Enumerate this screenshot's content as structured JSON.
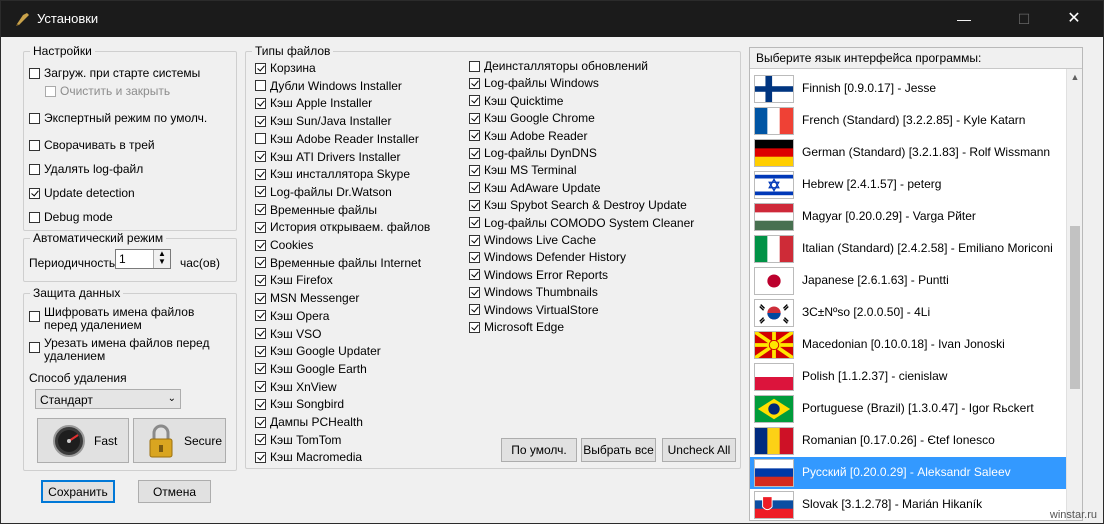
{
  "window": {
    "title": "Установки"
  },
  "settings": {
    "legend": "Настройки",
    "items": [
      {
        "label": "Загруж. при старте системы",
        "checked": false
      },
      {
        "label": "Очистить и закрыть",
        "checked": false,
        "disabled": true
      },
      {
        "label": "Экспертный режим по умолч.",
        "checked": false
      },
      {
        "label": "Сворачивать в трей",
        "checked": false
      },
      {
        "label": "Удалять log-файл",
        "checked": false
      },
      {
        "label": "Update detection",
        "checked": true
      },
      {
        "label": "Debug mode",
        "checked": false
      }
    ]
  },
  "auto": {
    "legend": "Автоматический режим",
    "period_label": "Периодичность:",
    "period_value": "1",
    "unit": "час(ов)"
  },
  "protect": {
    "legend": "Защита данных",
    "encrypt_label": "Шифровать имена файлов перед удалением",
    "trim_label": "Урезать имена файлов перед удалением",
    "method_label": "Способ удаления",
    "method_value": "Стандарт",
    "fast_label": "Fast",
    "secure_label": "Secure"
  },
  "filetypes": {
    "legend": "Типы файлов",
    "col1": [
      {
        "label": "Корзина",
        "checked": true
      },
      {
        "label": "Дубли Windows Installer",
        "checked": false
      },
      {
        "label": "Кэш Apple Installer",
        "checked": true
      },
      {
        "label": "Кэш Sun/Java Installer",
        "checked": true
      },
      {
        "label": "Кэш Adobe Reader Installer",
        "checked": false
      },
      {
        "label": "Кэш ATI Drivers Installer",
        "checked": true
      },
      {
        "label": "Кэш инсталлятора Skype",
        "checked": true
      },
      {
        "label": "Log-файлы Dr.Watson",
        "checked": true
      },
      {
        "label": "Временные файлы",
        "checked": true
      },
      {
        "label": "История открываем. файлов",
        "checked": true
      },
      {
        "label": "Cookies",
        "checked": true
      },
      {
        "label": "Временные файлы Internet",
        "checked": true
      },
      {
        "label": "Кэш Firefox",
        "checked": true
      },
      {
        "label": "MSN Messenger",
        "checked": true
      },
      {
        "label": "Кэш Opera",
        "checked": true
      },
      {
        "label": "Кэш VSO",
        "checked": true
      },
      {
        "label": "Кэш Google Updater",
        "checked": true
      },
      {
        "label": "Кэш Google Earth",
        "checked": true
      },
      {
        "label": "Кэш XnView",
        "checked": true
      },
      {
        "label": "Кэш Songbird",
        "checked": true
      },
      {
        "label": "Дампы PCHealth",
        "checked": true
      },
      {
        "label": "Кэш TomTom",
        "checked": true
      },
      {
        "label": "Кэш Macromedia",
        "checked": true
      }
    ],
    "col2": [
      {
        "label": "Деинсталляторы обновлений",
        "checked": false
      },
      {
        "label": "Log-файлы Windows",
        "checked": true
      },
      {
        "label": "Кэш Quicktime",
        "checked": true
      },
      {
        "label": "Кэш Google Chrome",
        "checked": true
      },
      {
        "label": "Кэш Adobe Reader",
        "checked": true
      },
      {
        "label": "Log-файлы DynDNS",
        "checked": true
      },
      {
        "label": "Кэш MS Terminal",
        "checked": true
      },
      {
        "label": "Кэш AdAware Update",
        "checked": true
      },
      {
        "label": "Кэш Spybot Search & Destroy Update",
        "checked": true
      },
      {
        "label": "Log-файлы COMODO System Cleaner",
        "checked": true
      },
      {
        "label": "Windows Live Cache",
        "checked": true
      },
      {
        "label": "Windows Defender History",
        "checked": true
      },
      {
        "label": "Windows Error Reports",
        "checked": true
      },
      {
        "label": "Windows Thumbnails",
        "checked": true
      },
      {
        "label": "Windows VirtualStore",
        "checked": true
      },
      {
        "label": "Microsoft Edge",
        "checked": true
      }
    ],
    "default_btn": "По умолч.",
    "select_all_btn": "Выбрать все",
    "uncheck_all_btn": "Uncheck All"
  },
  "language": {
    "header": "Выберите язык интерфейса программы:",
    "items": [
      {
        "label": "Finnish [0.9.0.17] - Jesse",
        "flag": "finland",
        "selected": false
      },
      {
        "label": "French (Standard) [3.2.2.85] - Kyle Katarn",
        "flag": "france",
        "selected": false
      },
      {
        "label": "German (Standard) [3.2.1.83] - Rolf Wissmann",
        "flag": "germany",
        "selected": false
      },
      {
        "label": " Hebrew [2.4.1.57] - peterg",
        "flag": "israel",
        "selected": false
      },
      {
        "label": "Magyar [0.20.0.29] - Varga Pйter",
        "flag": "hungary",
        "selected": false
      },
      {
        "label": "Italian (Standard) [2.4.2.58] - Emiliano Moriconi",
        "flag": "italy",
        "selected": false
      },
      {
        "label": "Japanese [2.6.1.63] - Puntti",
        "flag": "japan",
        "selected": false
      },
      {
        "label": "ЗС±Nºso [2.0.0.50] - 4Li",
        "flag": "korea",
        "selected": false
      },
      {
        "label": "Macedonian [0.10.0.18] - Ivan Jonoski",
        "flag": "macedonia",
        "selected": false
      },
      {
        "label": "Polish [1.1.2.37] - cienislaw",
        "flag": "poland",
        "selected": false
      },
      {
        "label": "Portuguese (Brazil) [1.3.0.47] - Igor Rьckert",
        "flag": "brazil",
        "selected": false
      },
      {
        "label": "Romanian [0.17.0.26] - Єtef Ionesco",
        "flag": "romania",
        "selected": false
      },
      {
        "label": "Русский [0.20.0.29] - Aleksandr Saleev",
        "flag": "russia",
        "selected": true
      },
      {
        "label": "Slovak [3.1.2.78] - Marián Hikaník",
        "flag": "slovakia",
        "selected": false
      }
    ]
  },
  "footer": {
    "save": "Сохранить",
    "cancel": "Отмена"
  },
  "watermark": "winstar.ru",
  "colors": {
    "selection": "#3399ff",
    "titlebar": "#1b1b1b"
  }
}
